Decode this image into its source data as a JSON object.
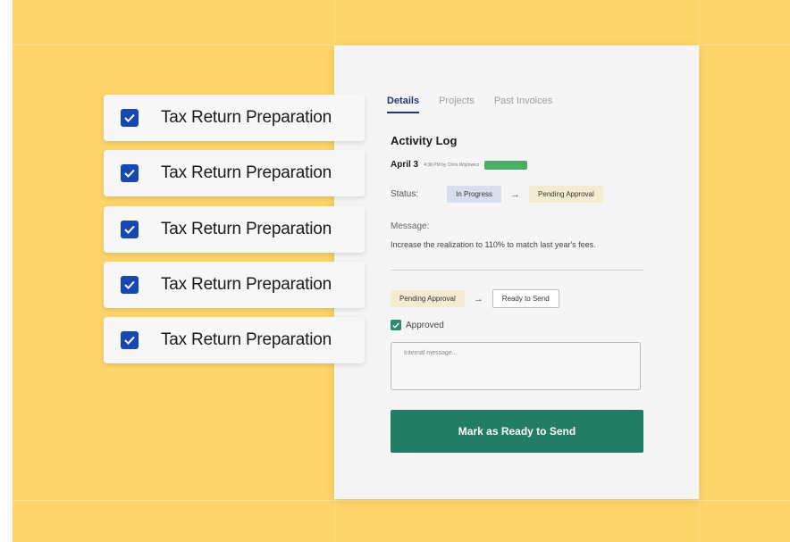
{
  "tasks": [
    {
      "label": "Tax Return Preparation",
      "checked": true
    },
    {
      "label": "Tax Return Preparation",
      "checked": true
    },
    {
      "label": "Tax Return Preparation",
      "checked": true
    },
    {
      "label": "Tax Return Preparation",
      "checked": true
    },
    {
      "label": "Tax Return Preparation",
      "checked": true
    }
  ],
  "panel": {
    "tabs": [
      {
        "label": "Details",
        "active": true
      },
      {
        "label": "Projects",
        "active": false
      },
      {
        "label": "Past Invoices",
        "active": false
      }
    ],
    "section_title": "Activity Log",
    "log_date": "April 3",
    "log_meta": "4:38 PM by Chris Wojtowicz",
    "status_label": "Status:",
    "status_from": "In Progress",
    "status_to": "Pending Approval",
    "message_label": "Message:",
    "message_text": "Increase the realization to 110% to match last year's fees.",
    "transition_from": "Pending Approval",
    "transition_to": "Ready to Send",
    "approved_label": "Approved",
    "approved_checked": true,
    "internal_message_placeholder": "Internal message...",
    "primary_button": "Mark as Ready to Send"
  },
  "colors": {
    "background": "#fdd56a",
    "checkbox": "#1747b0",
    "primary": "#237c66",
    "status_tag": "#4cae65"
  },
  "icons": {
    "checkmark": "check-icon",
    "arrow": "arrow-right-icon"
  }
}
